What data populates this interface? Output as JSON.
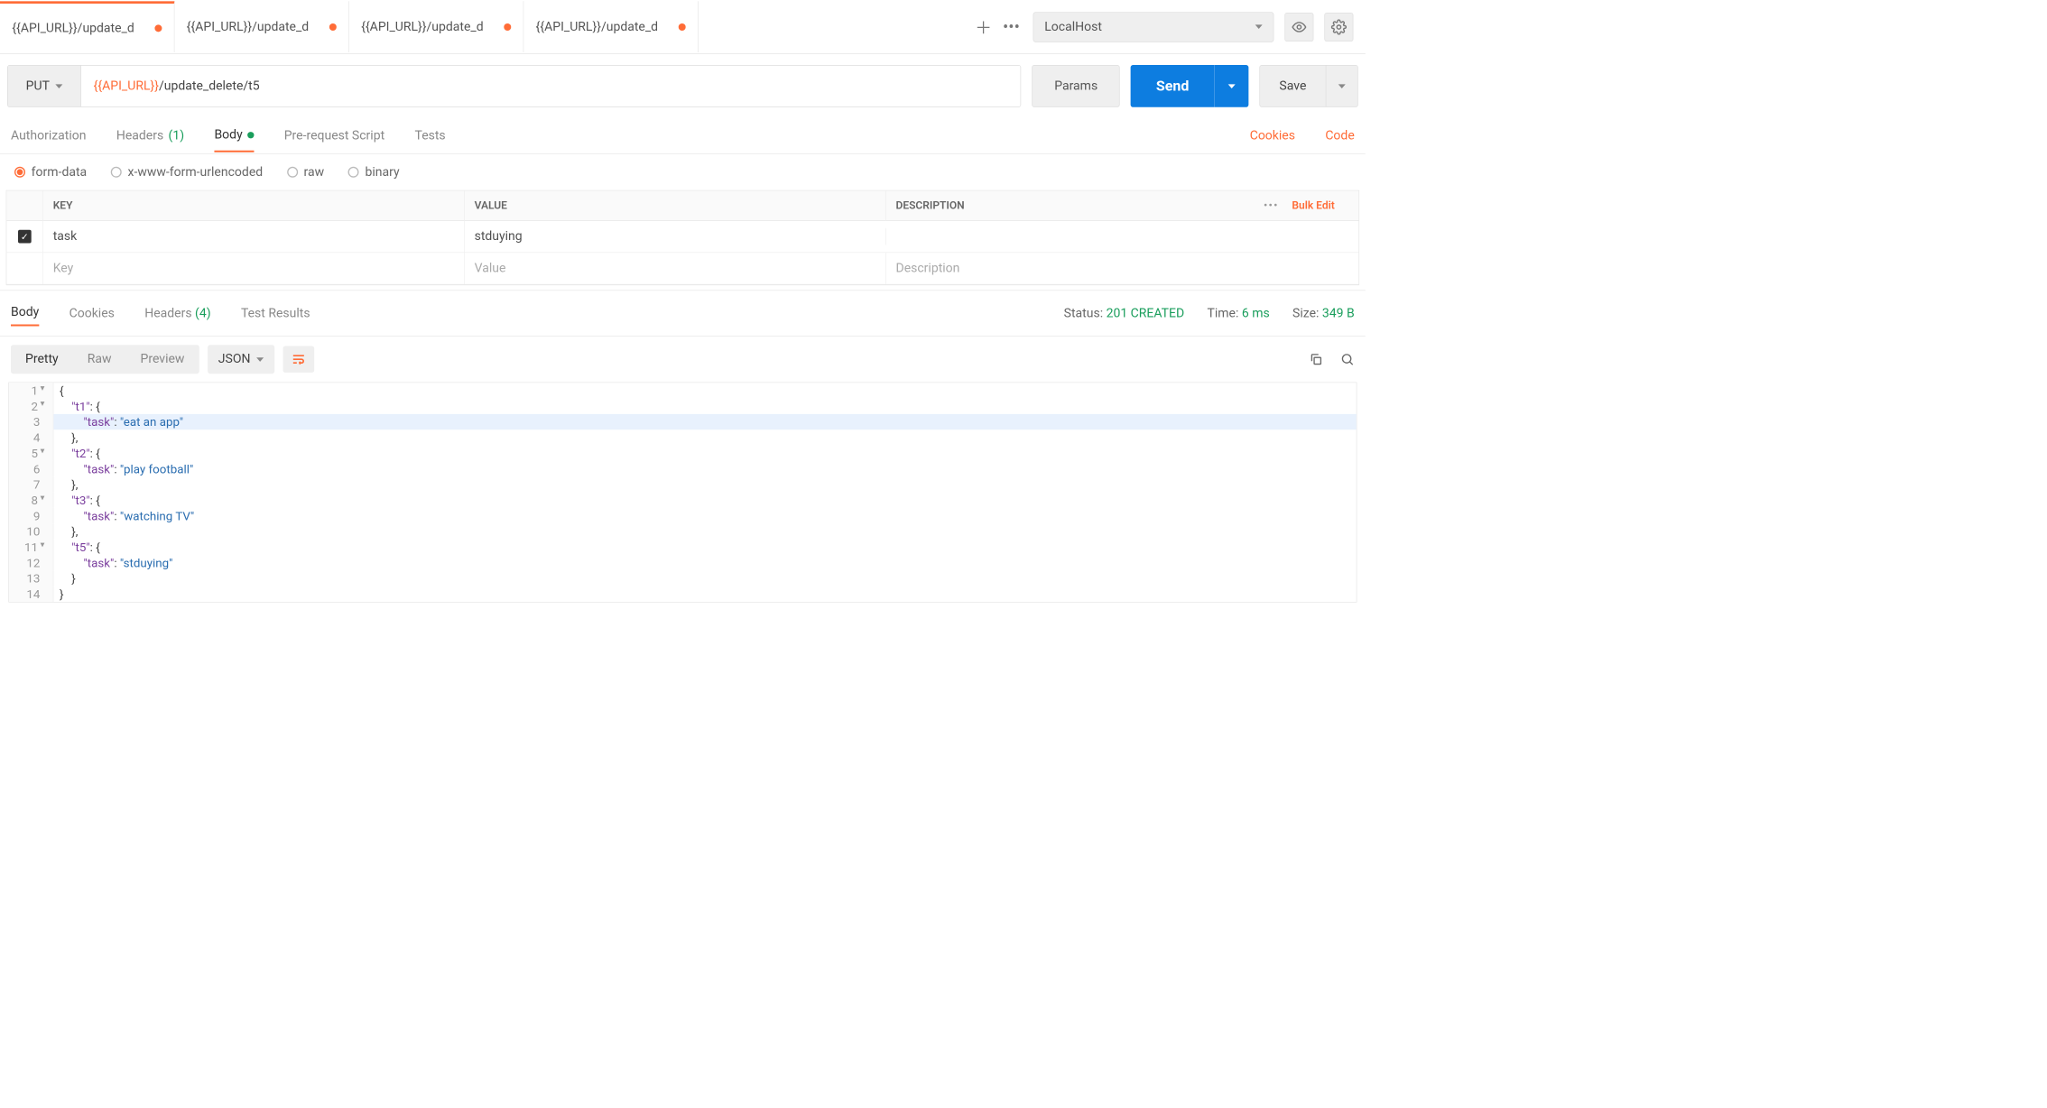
{
  "colors": {
    "accent": "#ff6c37",
    "primary": "#0d7de0",
    "success": "#1a9e5c"
  },
  "env": {
    "selected": "LocalHost"
  },
  "tabs": [
    {
      "label": "{{API_URL}}/update_d",
      "modified": true,
      "active": true
    },
    {
      "label": "{{API_URL}}/update_d",
      "modified": true,
      "active": false
    },
    {
      "label": "{{API_URL}}/update_d",
      "modified": true,
      "active": false
    },
    {
      "label": "{{API_URL}}/update_d",
      "modified": true,
      "active": false
    }
  ],
  "request": {
    "method": "PUT",
    "url_variable": "{{API_URL}}",
    "url_path": "/update_delete/t5",
    "params_label": "Params",
    "send_label": "Send",
    "save_label": "Save"
  },
  "req_tabs": {
    "authorization": "Authorization",
    "headers": "Headers",
    "headers_count": "(1)",
    "body": "Body",
    "prerequest": "Pre-request Script",
    "tests": "Tests",
    "cookies_link": "Cookies",
    "code_link": "Code"
  },
  "body_types": {
    "formdata": "form-data",
    "urlencoded": "x-www-form-urlencoded",
    "raw": "raw",
    "binary": "binary"
  },
  "kv": {
    "headers": {
      "key": "KEY",
      "value": "VALUE",
      "desc": "DESCRIPTION"
    },
    "bulk_edit": "Bulk Edit",
    "rows": [
      {
        "checked": true,
        "key": "task",
        "value": "stduying",
        "desc": ""
      }
    ],
    "placeholders": {
      "key": "Key",
      "value": "Value",
      "desc": "Description"
    }
  },
  "resp": {
    "tabs": {
      "body": "Body",
      "cookies": "Cookies",
      "headers": "Headers",
      "headers_count": "(4)",
      "test_results": "Test Results"
    },
    "status_label": "Status:",
    "status_value": "201 CREATED",
    "time_label": "Time:",
    "time_value": "6 ms",
    "size_label": "Size:",
    "size_value": "349 B",
    "views": {
      "pretty": "Pretty",
      "raw": "Raw",
      "preview": "Preview"
    },
    "format": "JSON"
  },
  "code": [
    {
      "n": 1,
      "fold": true,
      "seg": [
        {
          "c": "p",
          "t": "{"
        }
      ]
    },
    {
      "n": 2,
      "fold": true,
      "seg": [
        {
          "c": "p",
          "t": "    "
        },
        {
          "c": "k",
          "t": "\"t1\""
        },
        {
          "c": "p",
          "t": ": {"
        }
      ]
    },
    {
      "n": 3,
      "hl": true,
      "seg": [
        {
          "c": "p",
          "t": "        "
        },
        {
          "c": "k",
          "t": "\"task\""
        },
        {
          "c": "p",
          "t": ": "
        },
        {
          "c": "s",
          "t": "\"eat an app\""
        }
      ]
    },
    {
      "n": 4,
      "seg": [
        {
          "c": "p",
          "t": "    },"
        }
      ]
    },
    {
      "n": 5,
      "fold": true,
      "seg": [
        {
          "c": "p",
          "t": "    "
        },
        {
          "c": "k",
          "t": "\"t2\""
        },
        {
          "c": "p",
          "t": ": {"
        }
      ]
    },
    {
      "n": 6,
      "seg": [
        {
          "c": "p",
          "t": "        "
        },
        {
          "c": "k",
          "t": "\"task\""
        },
        {
          "c": "p",
          "t": ": "
        },
        {
          "c": "s",
          "t": "\"play football\""
        }
      ]
    },
    {
      "n": 7,
      "seg": [
        {
          "c": "p",
          "t": "    },"
        }
      ]
    },
    {
      "n": 8,
      "fold": true,
      "seg": [
        {
          "c": "p",
          "t": "    "
        },
        {
          "c": "k",
          "t": "\"t3\""
        },
        {
          "c": "p",
          "t": ": {"
        }
      ]
    },
    {
      "n": 9,
      "seg": [
        {
          "c": "p",
          "t": "        "
        },
        {
          "c": "k",
          "t": "\"task\""
        },
        {
          "c": "p",
          "t": ": "
        },
        {
          "c": "s",
          "t": "\"watching TV\""
        }
      ]
    },
    {
      "n": 10,
      "seg": [
        {
          "c": "p",
          "t": "    },"
        }
      ]
    },
    {
      "n": 11,
      "fold": true,
      "seg": [
        {
          "c": "p",
          "t": "    "
        },
        {
          "c": "k",
          "t": "\"t5\""
        },
        {
          "c": "p",
          "t": ": {"
        }
      ]
    },
    {
      "n": 12,
      "seg": [
        {
          "c": "p",
          "t": "        "
        },
        {
          "c": "k",
          "t": "\"task\""
        },
        {
          "c": "p",
          "t": ": "
        },
        {
          "c": "s",
          "t": "\"stduying\""
        }
      ]
    },
    {
      "n": 13,
      "seg": [
        {
          "c": "p",
          "t": "    }"
        }
      ]
    },
    {
      "n": 14,
      "seg": [
        {
          "c": "p",
          "t": "}"
        }
      ]
    }
  ]
}
